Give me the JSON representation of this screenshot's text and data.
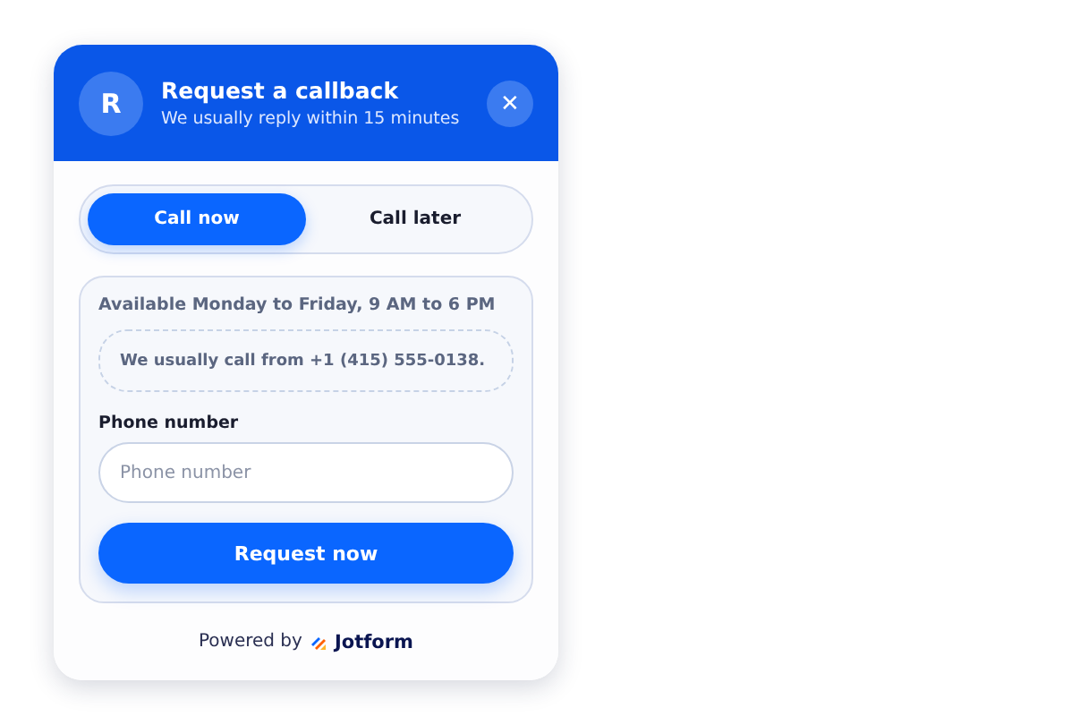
{
  "header": {
    "avatar": "R",
    "title": "Request a callback",
    "subtitle": "We usually reply within 15 minutes",
    "close": "✕"
  },
  "tabs": [
    {
      "label": "Call now",
      "selected": true
    },
    {
      "label": "Call later",
      "selected": false
    }
  ],
  "availability": "Available Monday to Friday, 9 AM to 6 PM",
  "notice": "We usually call from +1 (415) 555-0138.",
  "phone_field": {
    "label": "Phone number",
    "placeholder": "Phone number"
  },
  "submit": "Request now",
  "footer": {
    "text": "Powered by",
    "brand": "Jotform"
  }
}
